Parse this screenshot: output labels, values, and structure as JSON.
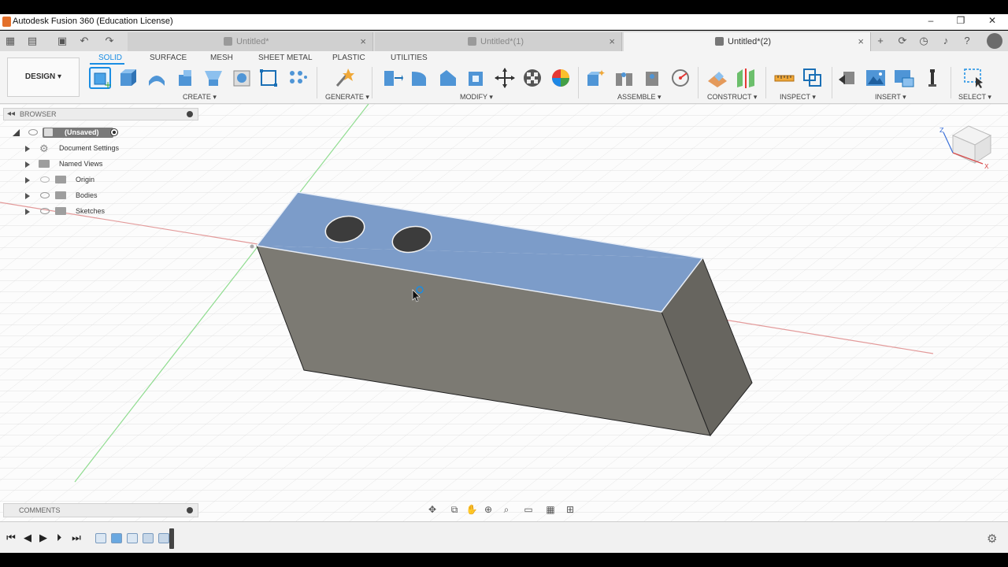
{
  "window": {
    "title": "Autodesk Fusion 360 (Education License)",
    "minimize": "–",
    "maximize": "❐",
    "close": "✕"
  },
  "tabs": [
    {
      "label": "Untitled*",
      "active": false
    },
    {
      "label": "Untitled*(1)",
      "active": false
    },
    {
      "label": "Untitled*(2)",
      "active": true
    }
  ],
  "tab_close": "×",
  "toolbar": {
    "design_label": "DESIGN ▾",
    "workspace_tabs": [
      "SOLID",
      "SURFACE",
      "MESH",
      "SHEET METAL",
      "PLASTIC",
      "UTILITIES"
    ],
    "groups": [
      "CREATE ▾",
      "GENERATE ▾",
      "MODIFY ▾",
      "ASSEMBLE ▾",
      "CONSTRUCT ▾",
      "INSPECT ▾",
      "INSERT ▾",
      "SELECT ▾"
    ]
  },
  "browser": {
    "title": "BROWSER",
    "root": "(Unsaved)",
    "items": [
      "Document Settings",
      "Named Views",
      "Origin",
      "Bodies",
      "Sketches"
    ]
  },
  "comments": {
    "title": "COMMENTS"
  },
  "viewcube": {
    "z_label": "Z",
    "x_label": "X"
  },
  "colors": {
    "accent": "#1a8de3",
    "face_top": "#7c9cc9",
    "face_front": "#7c7a73",
    "face_side": "#6a6862"
  }
}
